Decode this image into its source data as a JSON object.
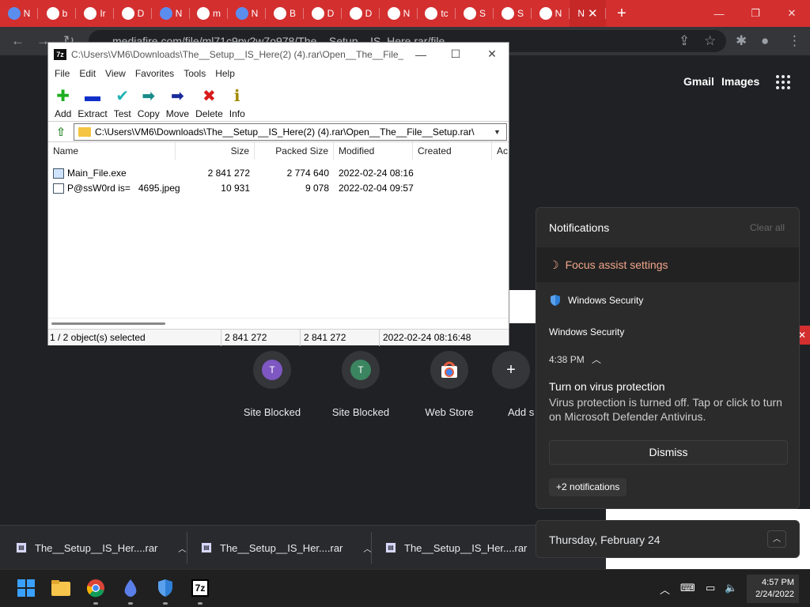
{
  "browser": {
    "tabs": [
      {
        "label": "N",
        "icon": "drop-icon",
        "color": "#5b8def"
      },
      {
        "label": "b",
        "icon": "google-icon",
        "color": "#ffffff"
      },
      {
        "label": "Ir",
        "icon": "building-icon",
        "color": "#ffffff"
      },
      {
        "label": "D",
        "icon": "download-icon",
        "color": "#ffffff"
      },
      {
        "label": "N",
        "icon": "drop-icon",
        "color": "#5b8def"
      },
      {
        "label": "m",
        "icon": "google-icon",
        "color": "#ffffff"
      },
      {
        "label": "N",
        "icon": "drop-icon",
        "color": "#5b8def"
      },
      {
        "label": "B",
        "icon": "doc-icon",
        "color": "#ffffff"
      },
      {
        "label": "D",
        "icon": "globe-icon",
        "color": "#ffffff"
      },
      {
        "label": "D",
        "icon": "globe-icon",
        "color": "#ffffff"
      },
      {
        "label": "N",
        "icon": "shield-tab-icon",
        "color": "#ffffff"
      },
      {
        "label": "tc",
        "icon": "google-icon",
        "color": "#ffffff"
      },
      {
        "label": "S",
        "icon": "globe-icon",
        "color": "#ffffff"
      },
      {
        "label": "S",
        "icon": "globe-icon",
        "color": "#ffffff"
      },
      {
        "label": "N",
        "icon": "shield-tab-icon",
        "color": "#ffffff"
      }
    ],
    "active_tab": {
      "label": "N",
      "close": "✕"
    },
    "new_tab": "+",
    "url": "mediafire.com/file/ml71c9py2w7o978/The__Setup__IS_Here.rar/file",
    "window_controls": {
      "min": "—",
      "max": "❐",
      "close": "✕"
    },
    "tabstrip_color": "#d32f2f"
  },
  "google": {
    "gmail": "Gmail",
    "images": "Images",
    "shortcuts": [
      {
        "label": "Site Blocked",
        "initial": "T",
        "color": "#7e57c2"
      },
      {
        "label": "Site Blocked",
        "initial": "T",
        "color": "#3b8560"
      },
      {
        "label": "Web Store",
        "initial": "",
        "color": "#e85d3c"
      },
      {
        "label": "Add s",
        "initial": "+",
        "color": "#35363a"
      }
    ]
  },
  "sevenzip": {
    "logo": "7z",
    "title": "C:\\Users\\VM6\\Downloads\\The__Setup__IS_Here(2) (4).rar\\Open__The__File__S...",
    "menu": [
      "File",
      "Edit",
      "View",
      "Favorites",
      "Tools",
      "Help"
    ],
    "toolbar": [
      {
        "label": "Add",
        "glyph": "✚",
        "color": "#1fae1f"
      },
      {
        "label": "Extract",
        "glyph": "▬",
        "color": "#1030c8"
      },
      {
        "label": "Test",
        "glyph": "✔",
        "color": "#1fb3b3"
      },
      {
        "label": "Copy",
        "glyph": "➡",
        "color": "#1a8a8a"
      },
      {
        "label": "Move",
        "glyph": "➡",
        "color": "#1a2c9a"
      },
      {
        "label": "Delete",
        "glyph": "✖",
        "color": "#d81b1b"
      },
      {
        "label": "Info",
        "glyph": "ℹ",
        "color": "#a08a00"
      }
    ],
    "address": "C:\\Users\\VM6\\Downloads\\The__Setup__IS_Here(2) (4).rar\\Open__The__File__Setup.rar\\",
    "columns": [
      "Name",
      "Size",
      "Packed Size",
      "Modified",
      "Created",
      "Ac"
    ],
    "files": [
      {
        "name": "Main_File.exe",
        "size": "2 841 272",
        "packed": "2 774 640",
        "modified": "2022-02-24 08:16",
        "created": ""
      },
      {
        "name": "P@ssW0rd is=   4695.jpeg",
        "size": "10 931",
        "packed": "9 078",
        "modified": "2022-02-04 09:57",
        "created": ""
      }
    ],
    "status": {
      "selected": "1 / 2 object(s) selected",
      "size": "2 841 272",
      "packed": "2 841 272",
      "modified": "2022-02-24 08:16:48"
    }
  },
  "downloads": [
    {
      "name": "The__Setup__IS_Her....rar"
    },
    {
      "name": "The__Setup__IS_Her....rar"
    },
    {
      "name": "The__Setup__IS_Her....rar"
    }
  ],
  "notifications": {
    "title": "Notifications",
    "clear_all": "Clear all",
    "focus_assist": "Focus assist settings",
    "app_name": "Windows Security",
    "group_name": "Windows Security",
    "time": "4:38 PM",
    "heading": "Turn on virus protection",
    "body": "Virus protection is turned off. Tap or click to turn on Microsoft Defender Antivirus.",
    "dismiss": "Dismiss",
    "more": "+2 notifications",
    "date": "Thursday, February 24"
  },
  "taskbar": {
    "apps": [
      "windows-start-icon",
      "file-explorer-icon",
      "chrome-icon",
      "drop-app-icon",
      "defender-icon",
      "sevenzip-app-icon"
    ],
    "clock_time": "4:57 PM",
    "clock_date": "2/24/2022"
  }
}
